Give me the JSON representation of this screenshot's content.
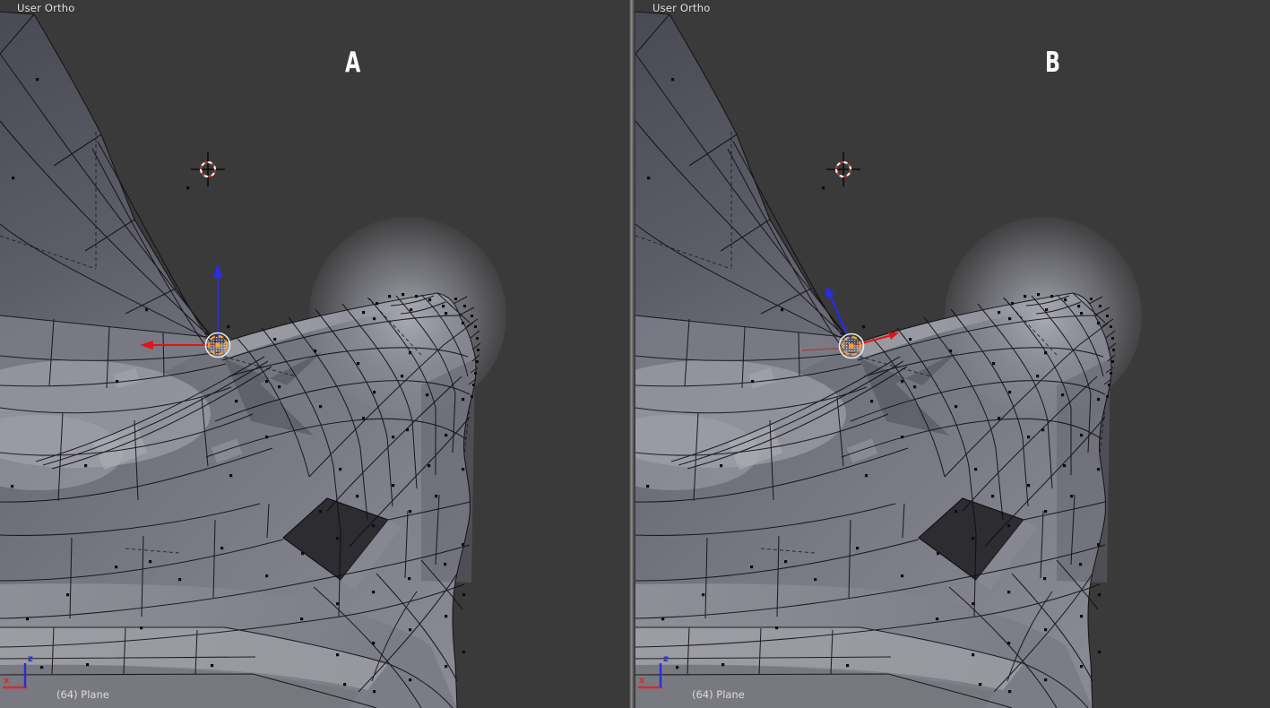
{
  "panels": [
    {
      "marker": "A",
      "view_mode_label": "User Ortho",
      "status_label": "(64) Plane"
    },
    {
      "marker": "B",
      "view_mode_label": "User Ortho",
      "status_label": "(64) Plane"
    }
  ],
  "mini_axis": {
    "x_label": "x",
    "z_label": "z"
  },
  "colors": {
    "viewport_background": "#3a3a3a",
    "wireframe": "#0d0d11",
    "axis_x_red": "#d92020",
    "axis_z_blue": "#2b2bdf",
    "gizmo_highlight_orange": "#f0a232",
    "cursor_ring_red": "#b43434",
    "cursor_ring_white": "#f0f0f0",
    "label_text": "#e4e4e4",
    "marker_text": "#fafafa",
    "area_divider": "#8d8d8d",
    "hole_shadow": "#2c2c31"
  }
}
